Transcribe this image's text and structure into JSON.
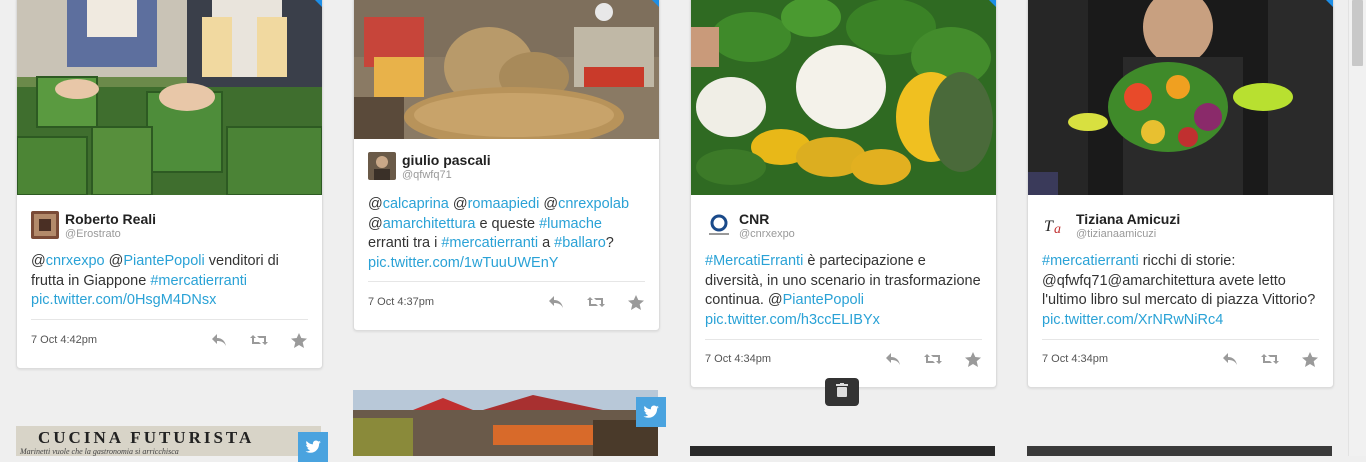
{
  "cards": [
    {
      "author": "Roberto Reali",
      "handle": "@Erostrato",
      "text_parts": [
        {
          "t": "@",
          "l": false
        },
        {
          "t": "cnrxexpo",
          "l": true
        },
        {
          "t": " @",
          "l": false
        },
        {
          "t": "PiantePopoli",
          "l": true
        },
        {
          "t": " venditori di frutta in Giappone ",
          "l": false
        },
        {
          "t": "#mercatierranti",
          "l": true
        },
        {
          "t": " ",
          "l": false
        },
        {
          "t": "pic.twitter.com/0HsgM4DNsx",
          "l": true
        }
      ],
      "time": "7 Oct 4:42pm"
    },
    {
      "author": "giulio pascali",
      "handle": "@qfwfq71",
      "text_parts": [
        {
          "t": "@",
          "l": false
        },
        {
          "t": "calcaprina",
          "l": true
        },
        {
          "t": " @",
          "l": false
        },
        {
          "t": "romaapiedi",
          "l": true
        },
        {
          "t": " @",
          "l": false
        },
        {
          "t": "cnrexpolab",
          "l": true
        },
        {
          "t": " @",
          "l": false
        },
        {
          "t": "amarchitettura",
          "l": true
        },
        {
          "t": " e queste ",
          "l": false
        },
        {
          "t": "#lumache",
          "l": true
        },
        {
          "t": " erranti tra i ",
          "l": false
        },
        {
          "t": "#mercatierranti",
          "l": true
        },
        {
          "t": " a ",
          "l": false
        },
        {
          "t": "#ballaro",
          "l": true
        },
        {
          "t": "? ",
          "l": false
        },
        {
          "t": "pic.twitter.com/1wTuuUWEnY",
          "l": true
        }
      ],
      "time": "7 Oct 4:37pm"
    },
    {
      "author": "CNR",
      "handle": "@cnrxexpo",
      "text_parts": [
        {
          "t": "#MercatiErranti",
          "l": true
        },
        {
          "t": " è partecipazione e diversità, in uno scenario in trasformazione continua. @",
          "l": false
        },
        {
          "t": "PiantePopoli",
          "l": true
        },
        {
          "t": " ",
          "l": false
        },
        {
          "t": "pic.twitter.com/h3ccELIBYx",
          "l": true
        }
      ],
      "time": "7 Oct 4:34pm"
    },
    {
      "author": "Tiziana Amicuzi",
      "handle": "@tizianaamicuzi",
      "text_parts": [
        {
          "t": "#mercatierranti",
          "l": true
        },
        {
          "t": " ricchi di storie: @qfwfq71@amarchitettura avete letto l'ultimo libro sul mercato di piazza Vittorio? ",
          "l": false
        },
        {
          "t": "pic.twitter.com/XrNRwNiRc4",
          "l": true
        }
      ],
      "time": "7 Oct 4:34pm"
    }
  ],
  "bottom": {
    "book_title": "CUCINA FUTURISTA",
    "book_subtitle": "Marinetti vuole che la gastronomia si arricchisca"
  },
  "icons": {
    "reply": "reply-icon",
    "retweet": "retweet-icon",
    "favorite": "star-icon",
    "delete": "trash-icon",
    "source": "twitter-bird-icon"
  },
  "colors": {
    "link": "#2aa2d6",
    "twitter_blue": "#4aa3df"
  }
}
